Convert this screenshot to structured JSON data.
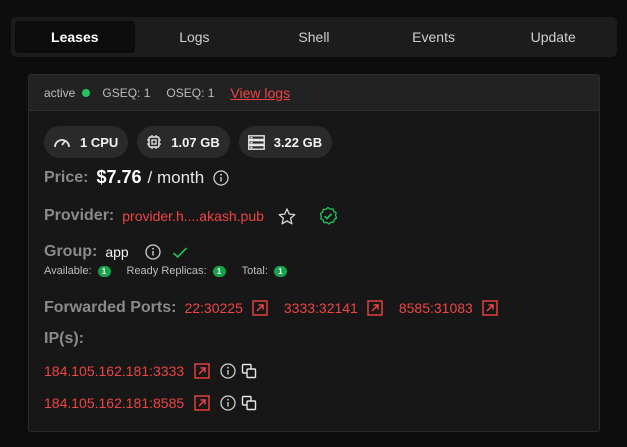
{
  "tabs": [
    "Leases",
    "Logs",
    "Shell",
    "Events",
    "Update"
  ],
  "lease": {
    "status": "active",
    "gseq": "GSEQ: 1",
    "oseq": "OSEQ: 1",
    "view_logs": "View logs"
  },
  "specs": {
    "cpu": "1 CPU",
    "memory": "1.07 GB",
    "storage": "3.22 GB"
  },
  "price": {
    "label": "Price:",
    "value": "$7.76",
    "unit": "/ month"
  },
  "provider": {
    "label": "Provider:",
    "value": "provider.h....akash.pub"
  },
  "group": {
    "label": "Group:",
    "value": "app",
    "available_label": "Available:",
    "available": "1",
    "ready_label": "Ready Replicas:",
    "ready": "1",
    "total_label": "Total:",
    "total": "1"
  },
  "forwarded_ports": {
    "label": "Forwarded Ports:",
    "ports": [
      "22:30225",
      "3333:32141",
      "8585:31083"
    ]
  },
  "ips": {
    "label": "IP(s):",
    "items": [
      "184.105.162.181:3333",
      "184.105.162.181:8585"
    ]
  },
  "colors": {
    "accent_red": "#ef4444",
    "status_green": "#22c55e"
  }
}
